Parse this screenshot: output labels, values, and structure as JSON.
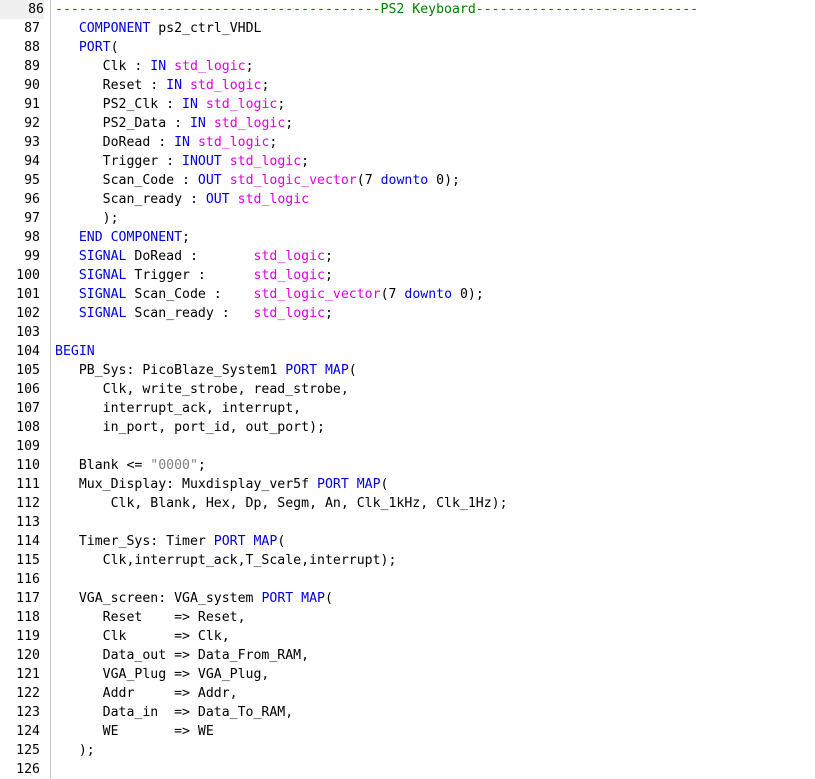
{
  "editor": {
    "language": "VHDL",
    "first_line": 86,
    "current_line": 86,
    "colors": {
      "keyword": "#0000e0",
      "type": "#e000e0",
      "comment": "#008000",
      "string": "#808080",
      "text": "#000000"
    },
    "lines": [
      {
        "n": "86",
        "segs": [
          [
            "cm",
            "-----------------------------------------PS2 Keyboard----------------------------"
          ]
        ]
      },
      {
        "n": "87",
        "segs": [
          [
            "tx",
            "   "
          ],
          [
            "kw",
            "COMPONENT"
          ],
          [
            "tx",
            " ps2_ctrl_VHDL"
          ]
        ]
      },
      {
        "n": "88",
        "segs": [
          [
            "tx",
            "   "
          ],
          [
            "kw",
            "PORT"
          ],
          [
            "tx",
            "("
          ]
        ]
      },
      {
        "n": "89",
        "segs": [
          [
            "tx",
            "      Clk : "
          ],
          [
            "kw",
            "IN"
          ],
          [
            "tx",
            " "
          ],
          [
            "ty",
            "std_logic"
          ],
          [
            "tx",
            ";"
          ]
        ]
      },
      {
        "n": "90",
        "segs": [
          [
            "tx",
            "      Reset : "
          ],
          [
            "kw",
            "IN"
          ],
          [
            "tx",
            " "
          ],
          [
            "ty",
            "std_logic"
          ],
          [
            "tx",
            ";"
          ]
        ]
      },
      {
        "n": "91",
        "segs": [
          [
            "tx",
            "      PS2_Clk : "
          ],
          [
            "kw",
            "IN"
          ],
          [
            "tx",
            " "
          ],
          [
            "ty",
            "std_logic"
          ],
          [
            "tx",
            ";"
          ]
        ]
      },
      {
        "n": "92",
        "segs": [
          [
            "tx",
            "      PS2_Data : "
          ],
          [
            "kw",
            "IN"
          ],
          [
            "tx",
            " "
          ],
          [
            "ty",
            "std_logic"
          ],
          [
            "tx",
            ";"
          ]
        ]
      },
      {
        "n": "93",
        "segs": [
          [
            "tx",
            "      DoRead : "
          ],
          [
            "kw",
            "IN"
          ],
          [
            "tx",
            " "
          ],
          [
            "ty",
            "std_logic"
          ],
          [
            "tx",
            ";"
          ]
        ]
      },
      {
        "n": "94",
        "segs": [
          [
            "tx",
            "      Trigger : "
          ],
          [
            "kw",
            "INOUT"
          ],
          [
            "tx",
            " "
          ],
          [
            "ty",
            "std_logic"
          ],
          [
            "tx",
            ";"
          ]
        ]
      },
      {
        "n": "95",
        "segs": [
          [
            "tx",
            "      Scan_Code : "
          ],
          [
            "kw",
            "OUT"
          ],
          [
            "tx",
            " "
          ],
          [
            "ty",
            "std_logic_vector"
          ],
          [
            "tx",
            "(7 "
          ],
          [
            "kw",
            "downto"
          ],
          [
            "tx",
            " 0);"
          ]
        ]
      },
      {
        "n": "96",
        "segs": [
          [
            "tx",
            "      Scan_ready : "
          ],
          [
            "kw",
            "OUT"
          ],
          [
            "tx",
            " "
          ],
          [
            "ty",
            "std_logic"
          ]
        ]
      },
      {
        "n": "97",
        "segs": [
          [
            "tx",
            "      );"
          ]
        ]
      },
      {
        "n": "98",
        "segs": [
          [
            "tx",
            "   "
          ],
          [
            "kw",
            "END COMPONENT"
          ],
          [
            "tx",
            ";"
          ]
        ]
      },
      {
        "n": "99",
        "segs": [
          [
            "tx",
            "   "
          ],
          [
            "kw",
            "SIGNAL"
          ],
          [
            "tx",
            " DoRead :       "
          ],
          [
            "ty",
            "std_logic"
          ],
          [
            "tx",
            ";"
          ]
        ]
      },
      {
        "n": "100",
        "segs": [
          [
            "tx",
            "   "
          ],
          [
            "kw",
            "SIGNAL"
          ],
          [
            "tx",
            " Trigger :      "
          ],
          [
            "ty",
            "std_logic"
          ],
          [
            "tx",
            ";"
          ]
        ]
      },
      {
        "n": "101",
        "segs": [
          [
            "tx",
            "   "
          ],
          [
            "kw",
            "SIGNAL"
          ],
          [
            "tx",
            " Scan_Code :    "
          ],
          [
            "ty",
            "std_logic_vector"
          ],
          [
            "tx",
            "(7 "
          ],
          [
            "kw",
            "downto"
          ],
          [
            "tx",
            " 0);"
          ]
        ]
      },
      {
        "n": "102",
        "segs": [
          [
            "tx",
            "   "
          ],
          [
            "kw",
            "SIGNAL"
          ],
          [
            "tx",
            " Scan_ready :   "
          ],
          [
            "ty",
            "std_logic"
          ],
          [
            "tx",
            ";"
          ]
        ]
      },
      {
        "n": "103",
        "segs": []
      },
      {
        "n": "104",
        "segs": [
          [
            "kw",
            "BEGIN"
          ]
        ]
      },
      {
        "n": "105",
        "segs": [
          [
            "tx",
            "   PB_Sys: PicoBlaze_System1 "
          ],
          [
            "kw",
            "PORT MAP"
          ],
          [
            "tx",
            "("
          ]
        ]
      },
      {
        "n": "106",
        "segs": [
          [
            "tx",
            "      Clk, write_strobe, read_strobe,"
          ]
        ]
      },
      {
        "n": "107",
        "segs": [
          [
            "tx",
            "      interrupt_ack, interrupt,"
          ]
        ]
      },
      {
        "n": "108",
        "segs": [
          [
            "tx",
            "      in_port, port_id, out_port);"
          ]
        ]
      },
      {
        "n": "109",
        "segs": []
      },
      {
        "n": "110",
        "segs": [
          [
            "tx",
            "   Blank <= "
          ],
          [
            "st",
            "\"0000\""
          ],
          [
            "tx",
            ";"
          ]
        ]
      },
      {
        "n": "111",
        "segs": [
          [
            "tx",
            "   Mux_Display: Muxdisplay_ver5f "
          ],
          [
            "kw",
            "PORT MAP"
          ],
          [
            "tx",
            "("
          ]
        ]
      },
      {
        "n": "112",
        "segs": [
          [
            "tx",
            "       Clk, Blank, Hex, Dp, Segm, An, Clk_1kHz, Clk_1Hz);"
          ]
        ]
      },
      {
        "n": "113",
        "segs": []
      },
      {
        "n": "114",
        "segs": [
          [
            "tx",
            "   Timer_Sys: Timer "
          ],
          [
            "kw",
            "PORT MAP"
          ],
          [
            "tx",
            "("
          ]
        ]
      },
      {
        "n": "115",
        "segs": [
          [
            "tx",
            "      Clk,interrupt_ack,T_Scale,interrupt);"
          ]
        ]
      },
      {
        "n": "116",
        "segs": []
      },
      {
        "n": "117",
        "segs": [
          [
            "tx",
            "   VGA_screen: VGA_system "
          ],
          [
            "kw",
            "PORT MAP"
          ],
          [
            "tx",
            "("
          ]
        ]
      },
      {
        "n": "118",
        "segs": [
          [
            "tx",
            "      Reset    => Reset,"
          ]
        ]
      },
      {
        "n": "119",
        "segs": [
          [
            "tx",
            "      Clk      => Clk,"
          ]
        ]
      },
      {
        "n": "120",
        "segs": [
          [
            "tx",
            "      Data_out => Data_From_RAM,"
          ]
        ]
      },
      {
        "n": "121",
        "segs": [
          [
            "tx",
            "      VGA_Plug => VGA_Plug,"
          ]
        ]
      },
      {
        "n": "122",
        "segs": [
          [
            "tx",
            "      Addr     => Addr,"
          ]
        ]
      },
      {
        "n": "123",
        "segs": [
          [
            "tx",
            "      Data_in  => Data_To_RAM,"
          ]
        ]
      },
      {
        "n": "124",
        "segs": [
          [
            "tx",
            "      WE       => WE"
          ]
        ]
      },
      {
        "n": "125",
        "segs": [
          [
            "tx",
            "   );"
          ]
        ]
      },
      {
        "n": "126",
        "segs": []
      }
    ]
  }
}
